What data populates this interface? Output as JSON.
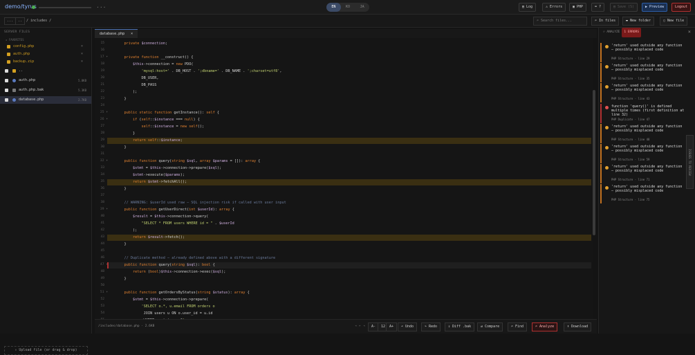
{
  "app": {
    "logo": "demo/tyrus",
    "dots": "..."
  },
  "langs": [
    "EN",
    "KO",
    "JA"
  ],
  "top_buttons": {
    "log": "Log",
    "errors": "Errors",
    "php": "PHP",
    "shortcuts": "?",
    "save": "Save (S)",
    "preview": "Preview",
    "logout": "Logout"
  },
  "crumb": {
    "back": "...",
    "up": "..",
    "path": "/ includes /",
    "search_placeholder": "Search files...",
    "in_files": "In files",
    "new_folder": "New folder",
    "new_file": "New file"
  },
  "sidebar": {
    "header": "SERVER FILES",
    "favorites_label": "FAVORITES",
    "favorites": [
      {
        "name": "config.php"
      },
      {
        "name": "auth.php"
      },
      {
        "name": "backup.zip"
      }
    ],
    "files": [
      {
        "name": "..",
        "size": ""
      },
      {
        "name": "auth.php",
        "size": "5.8KB"
      },
      {
        "name": "auth.php.bak",
        "size": "5.3KB"
      },
      {
        "name": "database.php",
        "size": "2.7KB"
      }
    ],
    "upload": "⇪ Upload file (or drag & drop)"
  },
  "editor": {
    "tab": "database.php",
    "close": "×"
  },
  "status": {
    "path": "/includes/database.php · 2.6KB",
    "nav": "◂ ▸ ◂",
    "font_minus": "A-",
    "font_size": "12",
    "font_plus": "A+",
    "undo": "Undo",
    "redo": "Redo",
    "diff": "Diff .bak",
    "compare": "Compare",
    "find": "Find",
    "analyze": "Analyze",
    "download": "Download"
  },
  "panel": {
    "title": "ANALYZE",
    "badge": "1 ERRORS",
    "close": "×",
    "vertical_tab": "ISSUES TO REVIEW",
    "issues": [
      {
        "text": "'return' used outside any function — possibly misplaced code",
        "meta": "PHP Structure · line 29",
        "kind": "warn"
      },
      {
        "text": "'return' used outside any function — possibly misplaced code",
        "meta": "PHP Structure · line 35",
        "kind": "warn"
      },
      {
        "text": "'return' used outside any function — possibly misplaced code",
        "meta": "PHP Structure · line 43",
        "kind": "warn"
      },
      {
        "text": "function 'query()' is defined multiple times (first definition at line 32)",
        "meta": "PHP Duplicate · line 47",
        "kind": "err"
      },
      {
        "text": "'return' used outside any function — possibly misplaced code",
        "meta": "PHP Structure · line 48",
        "kind": "warn"
      },
      {
        "text": "'return' used outside any function — possibly misplaced code",
        "meta": "PHP Structure · line 59",
        "kind": "warn"
      },
      {
        "text": "'return' used outside any function — possibly misplaced code",
        "meta": "PHP Structure · line 71",
        "kind": "warn"
      },
      {
        "text": "'return' used outside any function — possibly misplaced code",
        "meta": "PHP Structure · line 75",
        "kind": "warn"
      }
    ]
  },
  "code": [
    {
      "n": "15",
      "c": "    private $connection;"
    },
    {
      "n": "16",
      "c": ""
    },
    {
      "n": "17",
      "c": "    private function __construct() {"
    },
    {
      "n": "18",
      "c": "        $this->connection = new PDO("
    },
    {
      "n": "19",
      "c": "            'mysql:host=' . DB_HOST . ';dbname=' . DB_NAME . ';charset=utf8',"
    },
    {
      "n": "20",
      "c": "            DB_USER,"
    },
    {
      "n": "21",
      "c": "            DB_PASS"
    },
    {
      "n": "22",
      "c": "        );"
    },
    {
      "n": "23",
      "c": "    }"
    },
    {
      "n": "24",
      "c": ""
    },
    {
      "n": "25",
      "c": "    public static function getInstance(): self {"
    },
    {
      "n": "26",
      "c": "        if (self::$instance === null) {"
    },
    {
      "n": "27",
      "c": "            self::$instance = new self();"
    },
    {
      "n": "28",
      "c": "        }"
    },
    {
      "n": "29",
      "c": "        return self::$instance;"
    },
    {
      "n": "30",
      "c": "    }"
    },
    {
      "n": "31",
      "c": ""
    },
    {
      "n": "32",
      "c": "    public function query(string $sql, array $params = []): array {"
    },
    {
      "n": "33",
      "c": "        $stmt = $this->connection->prepare($sql);"
    },
    {
      "n": "34",
      "c": "        $stmt->execute($params);"
    },
    {
      "n": "35",
      "c": "        return $stmt->fetchAll();"
    },
    {
      "n": "36",
      "c": "    }"
    },
    {
      "n": "37",
      "c": ""
    },
    {
      "n": "38",
      "c": "    // WARNING: $userId used raw — SQL injection risk if called with user input"
    },
    {
      "n": "39",
      "c": "    public function getUserDirect(int $userId): array {"
    },
    {
      "n": "40",
      "c": "        $result = $this->connection->query("
    },
    {
      "n": "41",
      "c": "            \"SELECT * FROM users WHERE id = \" . $userId"
    },
    {
      "n": "42",
      "c": "        );"
    },
    {
      "n": "43",
      "c": "        return $result->fetch();"
    },
    {
      "n": "44",
      "c": "    }"
    },
    {
      "n": "45",
      "c": ""
    },
    {
      "n": "46",
      "c": "    // Duplicate method — already defined above with a different signature"
    },
    {
      "n": "47",
      "c": "    public function query(string $sql): bool {"
    },
    {
      "n": "48",
      "c": "        return (bool)$this->connection->exec($sql);"
    },
    {
      "n": "49",
      "c": "    }"
    },
    {
      "n": "50",
      "c": ""
    },
    {
      "n": "51",
      "c": "    public function getOrdersByStatus(string $status): array {"
    },
    {
      "n": "52",
      "c": "        $stmt = $this->connection->prepare("
    },
    {
      "n": "53",
      "c": "            'SELECT o.*, u.email FROM orders o"
    },
    {
      "n": "54",
      "c": "             JOIN users u ON o.user_id = u.id"
    },
    {
      "n": "55",
      "c": "             WHERE o.status = ?'"
    }
  ]
}
